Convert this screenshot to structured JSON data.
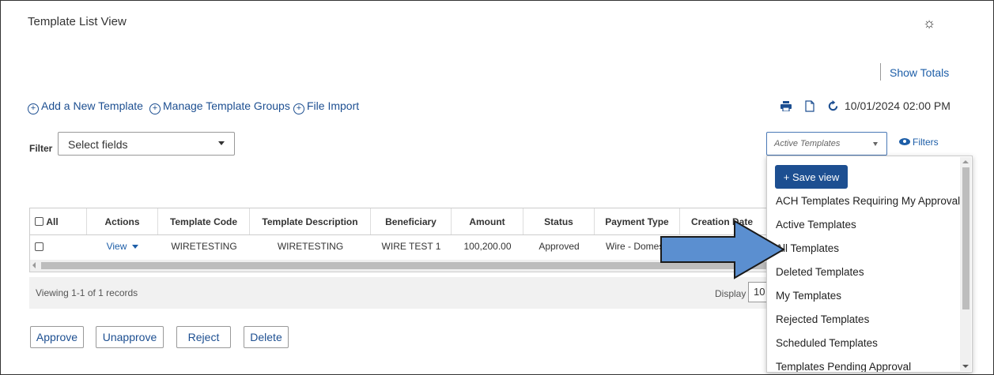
{
  "page": {
    "title": "Template List View",
    "show_totals": "Show Totals",
    "datetime": "10/01/2024 02:00 PM"
  },
  "actions": {
    "add_template": "Add a New Template",
    "manage_groups": "Manage Template Groups",
    "file_import": "File Import"
  },
  "filter": {
    "label": "Filter",
    "selected": "Select fields"
  },
  "view_select": {
    "selected": "Active Templates",
    "filters_link": "Filters"
  },
  "table": {
    "columns": [
      "All",
      "Actions",
      "Template Code",
      "Template Description",
      "Beneficiary",
      "Amount",
      "Status",
      "Payment Type",
      "Creation Date"
    ],
    "rows": [
      {
        "action": "View",
        "template_code": "WIRETESTING",
        "template_description": "WIRETESTING",
        "beneficiary": "WIRE TEST 1",
        "amount": "100,200.00",
        "status": "Approved",
        "payment_type": "Wire - Domestic",
        "creation_date": ""
      }
    ]
  },
  "pagination": {
    "viewing": "Viewing 1-1 of 1 records",
    "display_label": "Display",
    "display_value": "10"
  },
  "buttons": {
    "approve": "Approve",
    "unapprove": "Unapprove",
    "reject": "Reject",
    "delete": "Delete"
  },
  "dropdown": {
    "save_view": "+ Save view",
    "options": [
      "ACH Templates Requiring My Approval",
      "Active Templates",
      "All Templates",
      "Deleted Templates",
      "My Templates",
      "Rejected Templates",
      "Scheduled Templates",
      "Templates Pending Approval"
    ]
  },
  "colors": {
    "link": "#1d4f91",
    "primary_button": "#1d4f91",
    "arrow_fill": "#5b8fd0",
    "arrow_stroke": "#1a1a1a"
  },
  "icons": [
    "gear-icon",
    "print-icon",
    "export-icon",
    "refresh-icon",
    "eye-icon",
    "arrow-pointer"
  ]
}
